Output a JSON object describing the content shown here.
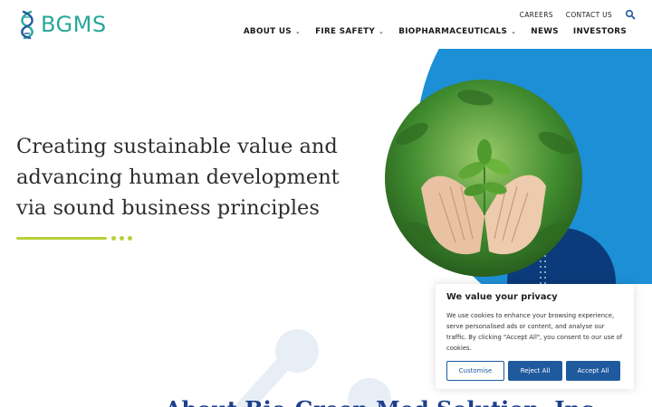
{
  "header": {
    "logo_text": "BGMS",
    "utility_links": [
      "CAREERS",
      "CONTACT US"
    ],
    "nav": [
      {
        "label": "ABOUT US",
        "has_dropdown": true
      },
      {
        "label": "FIRE SAFETY",
        "has_dropdown": true
      },
      {
        "label": "BIOPHARMACEUTICALS",
        "has_dropdown": true
      },
      {
        "label": "NEWS",
        "has_dropdown": false
      },
      {
        "label": "INVESTORS",
        "has_dropdown": false
      }
    ],
    "icons": [
      "search-icon",
      "chevron-down-icon"
    ]
  },
  "hero": {
    "title": "Creating sustainable value and advancing human development via sound business principles"
  },
  "about": {
    "heading": "About Bio-Green Med Solution, Inc."
  },
  "cookie": {
    "title": "We value your privacy",
    "body": "We use cookies to enhance your browsing experience, serve personalised ads or content, and analyse our traffic. By clicking \"Accept All\", you consent to our use of cookies.",
    "customise_label": "Customise",
    "reject_label": "Reject All",
    "accept_label": "Accept All"
  },
  "colors": {
    "brand_teal": "#2aa79b",
    "brand_blue": "#1f5a9e",
    "accent_lime": "#b9cf3a",
    "hero_blue": "#1d8fd6"
  }
}
